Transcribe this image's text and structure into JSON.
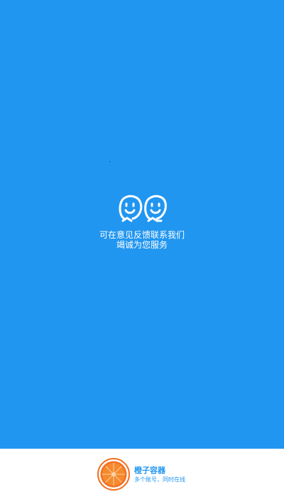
{
  "splash": {
    "background_color": "#2196F0",
    "mascot_icon": "two-smiley-faces-icon",
    "slogan_line1": "可在意见反馈联系我们",
    "slogan_line2": "竭诚为您服务"
  },
  "footer": {
    "logo_icon": "orange-slice-icon",
    "app_name": "橙子容器",
    "app_tagline": "多个账号，同时在线",
    "accent_color": "#2196F0",
    "brand_orange": "#F37021"
  }
}
